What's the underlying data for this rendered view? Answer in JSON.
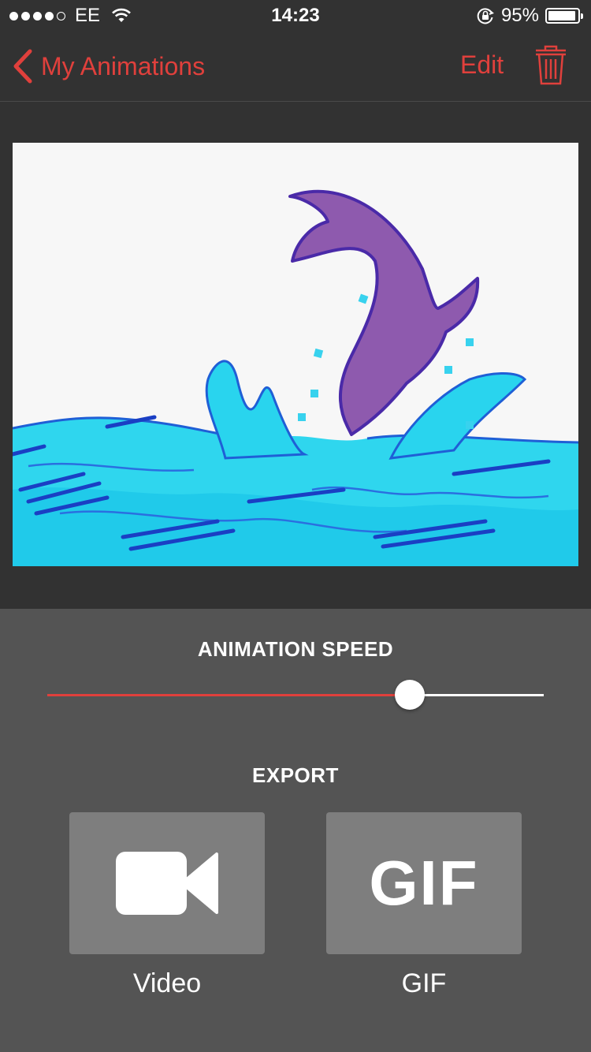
{
  "status_bar": {
    "carrier": "EE",
    "time": "14:23",
    "battery_percent": "95%",
    "battery_level": 0.95,
    "signal_bars_filled": 4,
    "signal_bars_total": 5,
    "icons": [
      "signal-dots-icon",
      "wifi-icon",
      "orientation-lock-icon",
      "battery-icon"
    ]
  },
  "nav": {
    "back_label": "My Animations",
    "edit_label": "Edit",
    "icons": [
      "chevron-left-icon",
      "trash-icon"
    ]
  },
  "speed": {
    "title": "ANIMATION SPEED",
    "value": 0.73
  },
  "export": {
    "title": "EXPORT",
    "video_label": "Video",
    "gif_label": "GIF",
    "gif_icon_text": "GIF",
    "icons": [
      "video-camera-icon"
    ]
  },
  "colors": {
    "accent": "#e0403c",
    "nav_bg": "#323232",
    "panel_bg": "#545454",
    "button_bg": "#7e7e7e"
  }
}
